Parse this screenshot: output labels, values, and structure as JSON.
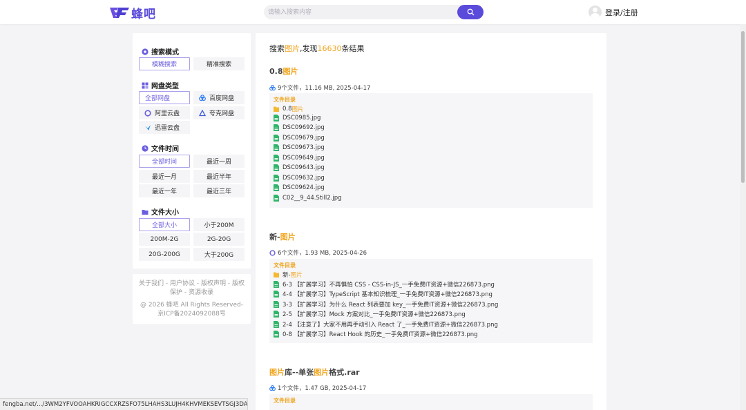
{
  "header": {
    "logo_text": "蜂吧",
    "search_placeholder": "请输入搜索内容",
    "login_label": "登录/注册"
  },
  "filters": {
    "search_mode": {
      "title": "搜索模式",
      "options": [
        "模糊搜索",
        "精准搜索"
      ],
      "active": "模糊搜索"
    },
    "disk_type": {
      "title": "网盘类型",
      "options": [
        "全部网盘",
        "百度网盘",
        "阿里云盘",
        "夸克网盘",
        "迅雷云盘"
      ],
      "active": "全部网盘"
    },
    "file_time": {
      "title": "文件时间",
      "options": [
        "全部时间",
        "最近一周",
        "最近一月",
        "最近半年",
        "最近一年",
        "最近三年"
      ],
      "active": "全部时间"
    },
    "file_size": {
      "title": "文件大小",
      "options": [
        "全部大小",
        "小于200M",
        "200M-2G",
        "2G-20G",
        "20G-200G",
        "大于200G"
      ],
      "active": "全部大小"
    }
  },
  "footer": {
    "links": "关于我们 - 用户协议 - 版权声明 - 版权保护 - 资源收录",
    "copyright": "@ 2026 蜂吧 All Rights Reserved-京ICP备2024092088号"
  },
  "results_summary": {
    "prefix": "搜索",
    "keyword": "图片",
    "middle": ",发现",
    "count": "16630",
    "suffix": "条结果"
  },
  "results": [
    {
      "title_prefix": "0.8",
      "title_keyword": "图片",
      "title_suffix": "",
      "meta": "9个文件，11.16 MB, 2025-04-17",
      "source": "baidu",
      "dir_label": "文件目录",
      "folder": {
        "prefix": "0.8",
        "keyword": "图片",
        "suffix": ""
      },
      "files": [
        "DSC0985.jpg",
        "DSC09692.jpg",
        "DSC09679.jpg",
        "DSC09673.jpg",
        "DSC09649.jpg",
        "DSC09643.jpg",
        "DSC09632.jpg",
        "DSC09624.jpg",
        "C02__9_44.Still2.jpg"
      ]
    },
    {
      "title_prefix": "新-",
      "title_keyword": "图片",
      "title_suffix": "",
      "meta": "6个文件，1.93 MB, 2025-04-26",
      "source": "aliyun",
      "dir_label": "文件目录",
      "folder": {
        "prefix": "新-",
        "keyword": "图片",
        "suffix": ""
      },
      "files": [
        "6-3 【扩展学习】不再惧怕 CSS - CSS-in-JS_一手免费IT资源+微信226873.png",
        "4-4 【扩展学习】TypeScript 基本知识梳理_一手免费IT资源+微信226873.png",
        "3-3 【扩展学习】为什么 React 列表要加 key_一手免费IT资源+微信226873.png",
        "2-5 【扩展学习】Mock 方案对比_一手免费IT资源+微信226873.png",
        "2-4 【注意了】大家不用再手动引入 React 了_一手免费IT资源+微信226873.png",
        "0-8 【扩展学习】React Hook 的历史_一手免费IT资源+微信226873.png"
      ]
    },
    {
      "title_prefix": "",
      "title_keyword": "图片",
      "title_mid": "库--单张",
      "title_keyword2": "图片",
      "title_suffix": "格式.rar",
      "meta": "1个文件，1.47 GB, 2025-04-17",
      "source": "baidu",
      "dir_label": "文件目录"
    }
  ],
  "status_bar": "fengba.net/.../3WM2YFVOOAHKRIGCCXRZSFO75LHAHS3LUJH4KHVMEKSEVTSGJ3DA",
  "colors": {
    "brand": "#5b4bdb",
    "highlight": "#f0a31a",
    "file_green": "#2fb56a",
    "folder_yellow": "#f5b82e"
  }
}
